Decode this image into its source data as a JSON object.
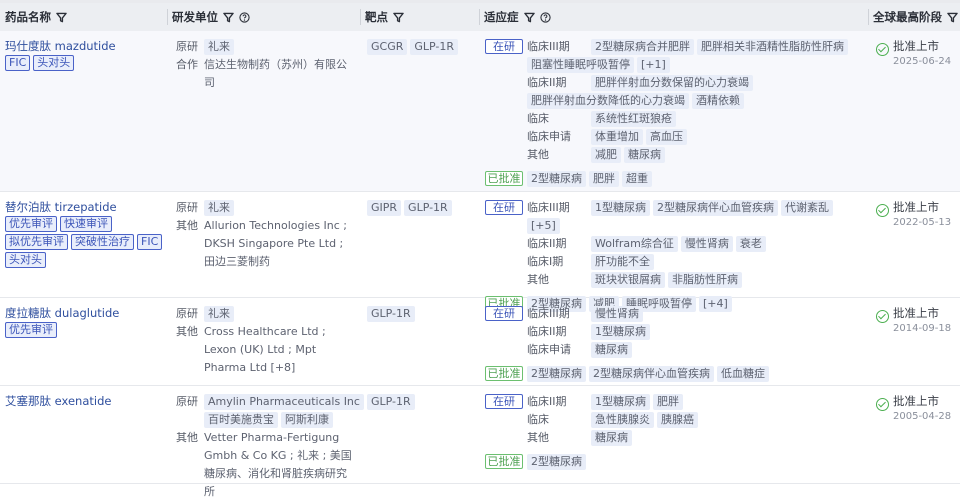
{
  "header": {
    "name": "药品名称",
    "org": "研发单位",
    "target": "靶点",
    "indication": "适应症",
    "stage": "全球最高阶段"
  },
  "colors": {
    "link": "#2f4f9e",
    "research_badge": "#4a62c8",
    "approved_badge": "#6cc070",
    "check": "#4caf50"
  },
  "rows": [
    {
      "name": "玛仕度肽 mazdutide",
      "flags": [
        "FIC",
        "头对头"
      ],
      "orgs": [
        {
          "label": "原研",
          "tags": [
            "礼来"
          ]
        },
        {
          "label": "合作",
          "text": "信达生物制药（苏州）有限公司"
        }
      ],
      "targets": [
        "GCGR",
        "GLP-1R"
      ],
      "research_label": "在研",
      "phases": [
        {
          "label": "临床III期",
          "tags": [
            "2型糖尿病合并肥胖",
            "肥胖相关非酒精性脂肪性肝病",
            "阻塞性睡眠呼吸暂停",
            "[+1]"
          ]
        },
        {
          "label": "临床II期",
          "tags": [
            "肥胖伴射血分数保留的心力衰竭",
            "肥胖伴射血分数降低的心力衰竭",
            "酒精依赖"
          ]
        },
        {
          "label": "临床",
          "tags": [
            "系统性红斑狼疮"
          ]
        },
        {
          "label": "临床申请",
          "tags": [
            "体重增加",
            "高血压"
          ]
        },
        {
          "label": "其他",
          "tags": [
            "减肥",
            "糖尿病"
          ]
        }
      ],
      "approved_label": "已批准",
      "approved": [
        "2型糖尿病",
        "肥胖",
        "超重"
      ],
      "stage": "批准上市",
      "date": "2025-06-24"
    },
    {
      "name": "替尔泊肽 tirzepatide",
      "flags": [
        "优先审评",
        "快速审评",
        "拟优先审评",
        "突破性治疗",
        "FIC",
        "头对头"
      ],
      "orgs": [
        {
          "label": "原研",
          "tags": [
            "礼来"
          ]
        },
        {
          "label": "其他",
          "text": "Allurion Technologies Inc ; DKSH Singapore Pte Ltd ; 田边三菱制药"
        }
      ],
      "targets": [
        "GIPR",
        "GLP-1R"
      ],
      "research_label": "在研",
      "phases": [
        {
          "label": "临床III期",
          "tags": [
            "1型糖尿病",
            "2型糖尿病伴心血管疾病",
            "代谢紊乱",
            "[+5]"
          ]
        },
        {
          "label": "临床II期",
          "tags": [
            "Wolfram综合征",
            "慢性肾病",
            "衰老"
          ]
        },
        {
          "label": "临床I期",
          "tags": [
            "肝功能不全"
          ]
        },
        {
          "label": "其他",
          "tags": [
            "斑块状银屑病",
            "非脂肪性肝病"
          ]
        }
      ],
      "approved_label": "已批准",
      "approved": [
        "2型糖尿病",
        "减肥",
        "睡眠呼吸暂停",
        "[+4]"
      ],
      "stage": "批准上市",
      "date": "2022-05-13"
    },
    {
      "name": "度拉糖肽 dulaglutide",
      "flags": [
        "优先审评"
      ],
      "orgs": [
        {
          "label": "原研",
          "tags": [
            "礼来"
          ]
        },
        {
          "label": "其他",
          "text": "Cross Healthcare Ltd ; Lexon (UK) Ltd ; Mpt Pharma Ltd [+8]"
        }
      ],
      "targets": [
        "GLP-1R"
      ],
      "research_label": "在研",
      "phases": [
        {
          "label": "临床III期",
          "tags": [
            "慢性肾病"
          ]
        },
        {
          "label": "临床II期",
          "tags": [
            "1型糖尿病"
          ]
        },
        {
          "label": "临床申请",
          "tags": [
            "糖尿病"
          ]
        }
      ],
      "approved_label": "已批准",
      "approved": [
        "2型糖尿病",
        "2型糖尿病伴心血管疾病",
        "低血糖症"
      ],
      "stage": "批准上市",
      "date": "2014-09-18"
    },
    {
      "name": "艾塞那肽 exenatide",
      "flags": [],
      "orgs": [
        {
          "label": "原研",
          "tags": [
            "Amylin Pharmaceuticals Inc",
            "百时美施贵宝",
            "阿斯利康"
          ]
        },
        {
          "label": "其他",
          "text": "Vetter Pharma-Fertigung Gmbh & Co KG ; 礼来 ; 美国糖尿病、消化和肾脏疾病研究所"
        }
      ],
      "targets": [
        "GLP-1R"
      ],
      "research_label": "在研",
      "phases": [
        {
          "label": "临床II期",
          "tags": [
            "1型糖尿病",
            "肥胖"
          ]
        },
        {
          "label": "临床",
          "tags": [
            "急性胰腺炎",
            "胰腺癌"
          ]
        },
        {
          "label": "其他",
          "tags": [
            "糖尿病"
          ]
        }
      ],
      "approved_label": "已批准",
      "approved": [
        "2型糖尿病"
      ],
      "stage": "批准上市",
      "date": "2005-04-28"
    }
  ]
}
